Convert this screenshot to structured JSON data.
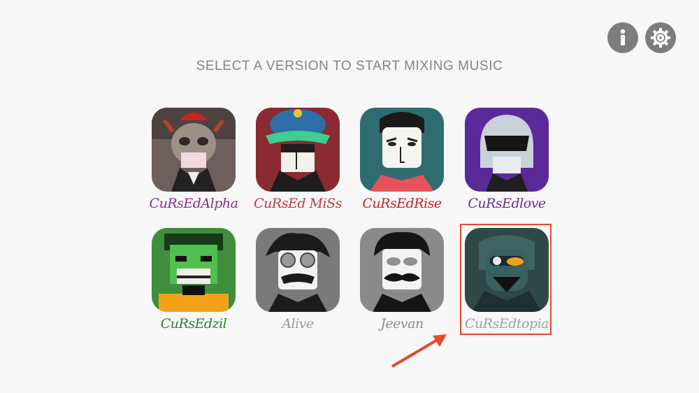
{
  "header": {
    "title": "SELECT A VERSION TO START MIXING MUSIC",
    "info_icon": "info-icon",
    "settings_icon": "gear-icon"
  },
  "versions": [
    {
      "label": "CuRsEdAlpha",
      "color": "#8a2f86"
    },
    {
      "label": "CuRsEd MiSs",
      "color": "#c2383f"
    },
    {
      "label": "CuRsEdRise",
      "color": "#c81f22"
    },
    {
      "label": "CuRsEdlove",
      "color": "#6a2d8a"
    },
    {
      "label": "CuRsEdzil",
      "color": "#2f7d2c"
    },
    {
      "label": "Alive",
      "color": "#9a9a9a"
    },
    {
      "label": "Jeevan",
      "color": "#8a8a8a"
    },
    {
      "label": "CuRsEdtopia",
      "color": "#9aa3a3"
    }
  ],
  "annotation": {
    "highlight_color": "#e8472c"
  }
}
